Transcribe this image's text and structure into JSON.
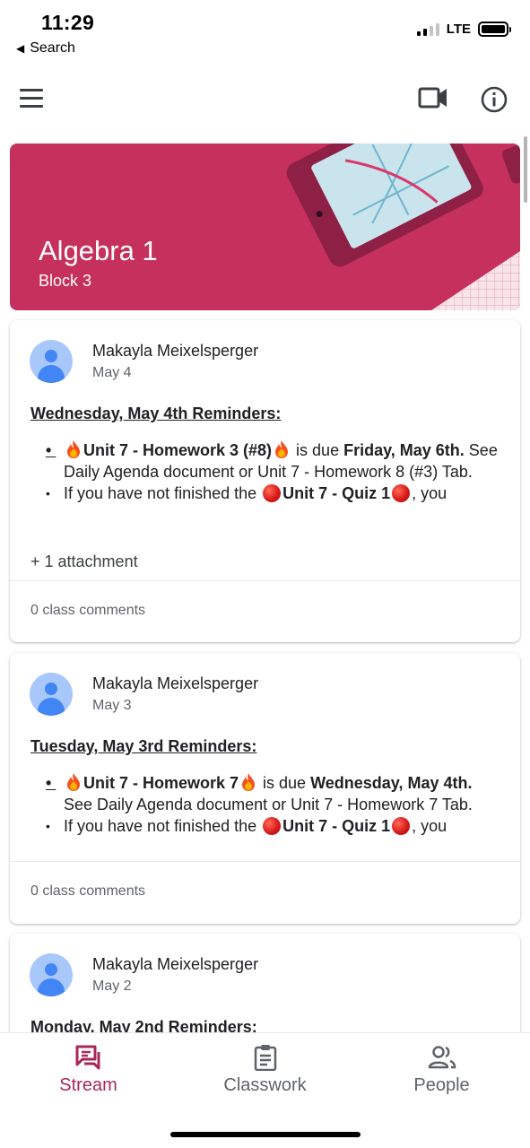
{
  "status_bar": {
    "time": "11:29",
    "back_label": "Search",
    "network": "LTE"
  },
  "app_bar": {
    "menu_icon": "hamburger-menu-icon",
    "video_icon": "video-camera-icon",
    "info_icon": "info-icon"
  },
  "banner": {
    "title": "Algebra 1",
    "subtitle": "Block 3",
    "color": "#c5305c"
  },
  "posts": [
    {
      "author": "Makayla Meixelsperger",
      "date": "May 4",
      "heading": "Wednesday, May 4th Reminders:",
      "item1": {
        "bold_title": "Unit 7 - Homework 3 (#8)",
        "mid": " is due ",
        "bold_due": "Friday, May 6th.",
        "rest": " See Daily Agenda document or Unit 7 - Homework 8 (#3) Tab."
      },
      "item2": {
        "prefix": "If you have not finished the ",
        "bold": "Unit 7 - Quiz 1",
        "suffix": ", you"
      },
      "attachment": "+ 1 attachment",
      "comments": "0 class comments"
    },
    {
      "author": "Makayla Meixelsperger",
      "date": "May 3",
      "heading": "Tuesday, May 3rd Reminders:",
      "item1": {
        "bold_title": "Unit 7 - Homework 7",
        "mid": " is due ",
        "bold_due": "Wednesday, May 4th.",
        "rest": " See Daily Agenda document or Unit 7 - Homework 7 Tab."
      },
      "item2": {
        "prefix": "If you have not finished the ",
        "bold": "Unit 7 - Quiz 1",
        "suffix": ", you"
      },
      "comments": "0 class comments"
    },
    {
      "author": "Makayla Meixelsperger",
      "date": "May 2",
      "heading": "Monday, May 2nd Reminders:"
    }
  ],
  "bottom_nav": {
    "items": [
      {
        "label": "Stream",
        "icon": "stream-icon",
        "active": true
      },
      {
        "label": "Classwork",
        "icon": "clipboard-icon",
        "active": false
      },
      {
        "label": "People",
        "icon": "people-icon",
        "active": false
      }
    ],
    "active_color": "#a8285a"
  }
}
